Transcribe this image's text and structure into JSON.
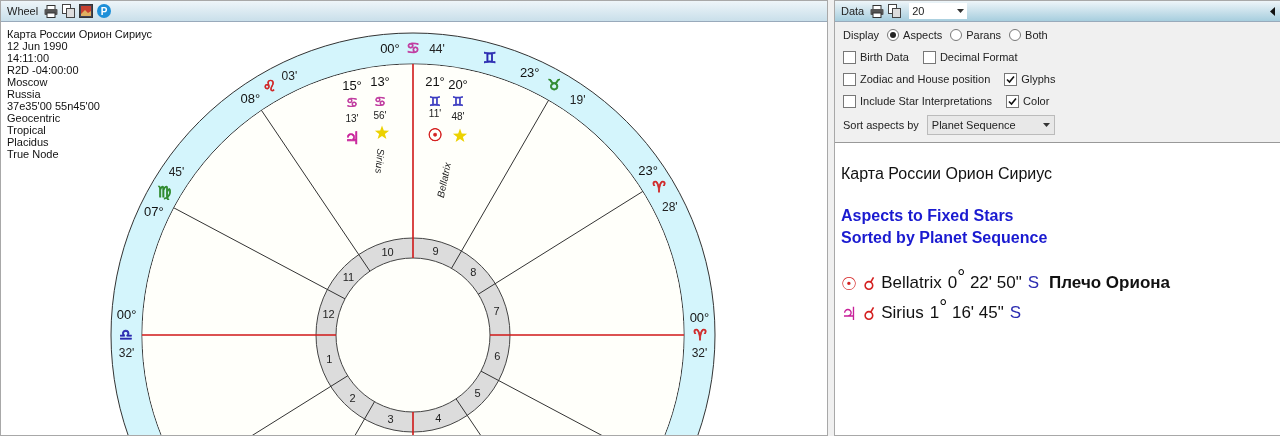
{
  "wheel_panel": {
    "title": "Wheel",
    "badge": "P",
    "chart_info": [
      "Карта России Орион Сириус",
      "12 Jun 1990",
      "14:11:00",
      "R2D -04:00:00",
      "Moscow",
      "Russia",
      "37e35'00 55n45'00",
      "Geocentric",
      "Tropical",
      "Placidus",
      "True Node"
    ]
  },
  "wheel": {
    "house_numbers": [
      "1",
      "2",
      "3",
      "4",
      "5",
      "6",
      "7",
      "8",
      "9",
      "10",
      "11",
      "12"
    ],
    "cusps": [
      {
        "degree": "00°",
        "sign": "♎",
        "minute": "32'",
        "color": "#2a2ab0"
      },
      {
        "degree": "07°",
        "sign": "♍",
        "minute": "45'",
        "color": "#2e8a2e"
      },
      {
        "degree": "08°",
        "sign": "♌",
        "minute": "03'",
        "color": "#d02828"
      },
      {
        "degree": "00°",
        "sign": "♋",
        "minute": "44'",
        "color": "#c03ca0"
      },
      {
        "degree": "23°",
        "sign": "♉",
        "minute": "19'",
        "color": "#2e8a2e"
      },
      {
        "degree": "23°",
        "sign": "♈",
        "minute": "28'",
        "color": "#d02828"
      },
      {
        "degree": "00°",
        "sign": "♈",
        "minute": "32'",
        "color": "#d02828"
      }
    ],
    "intercepted_signs": [
      {
        "sign": "♊",
        "color": "#2a2ab0"
      }
    ],
    "points": [
      {
        "kind": "planet",
        "glyph": "♃",
        "degree": "15°",
        "sign": {
          "glyph": "♋",
          "color": "#c03ca0"
        },
        "minute": "13'",
        "color": "#c8209a"
      },
      {
        "kind": "star",
        "name": "Sirius",
        "degree": "13°",
        "sign": {
          "glyph": "♋",
          "color": "#c03ca0"
        },
        "minute": "56'"
      },
      {
        "kind": "planet",
        "glyph": "☉",
        "degree": "21°",
        "sign": {
          "glyph": "♊",
          "color": "#3a3ac0"
        },
        "minute": "11'",
        "color": "#d42020"
      },
      {
        "kind": "star",
        "name": "Bellatrix",
        "degree": "20°",
        "sign": {
          "glyph": "♊",
          "color": "#3a3ac0"
        },
        "minute": "48'"
      }
    ]
  },
  "data_panel": {
    "title": "Data",
    "count": "20",
    "display_label": "Display",
    "display_options": [
      {
        "label": "Aspects",
        "selected": true
      },
      {
        "label": "Parans",
        "selected": false
      },
      {
        "label": "Both",
        "selected": false
      }
    ],
    "option_rows": [
      {
        "items": [
          {
            "label": "Birth Data",
            "checked": false
          },
          {
            "label": "Decimal Format",
            "checked": false
          }
        ]
      },
      {
        "items": [
          {
            "label": "Zodiac and House position",
            "checked": false
          },
          {
            "label": "Glyphs",
            "checked": true
          }
        ]
      },
      {
        "items": [
          {
            "label": "Include Star Interpretations",
            "checked": false
          },
          {
            "label": "Color",
            "checked": true
          }
        ]
      }
    ],
    "sort_label": "Sort aspects by",
    "sort_value": "Planet Sequence"
  },
  "report": {
    "title": "Карта России Орион Сириус",
    "headings": [
      "Aspects to Fixed Stars",
      "Sorted by Planet Sequence"
    ],
    "aspects": [
      {
        "planet": "☉",
        "color": "#d42020",
        "aspect": "☌",
        "star": "Bellatrix",
        "position": "0$^{°}$ 22' 50\"",
        "direction": "S",
        "note": "Плечо Ориона"
      },
      {
        "planet": "♃",
        "color": "#c8209a",
        "aspect": "☌",
        "star": "Sirius",
        "position": "1$^{°}$ 16' 45\"",
        "direction": "S"
      }
    ]
  }
}
